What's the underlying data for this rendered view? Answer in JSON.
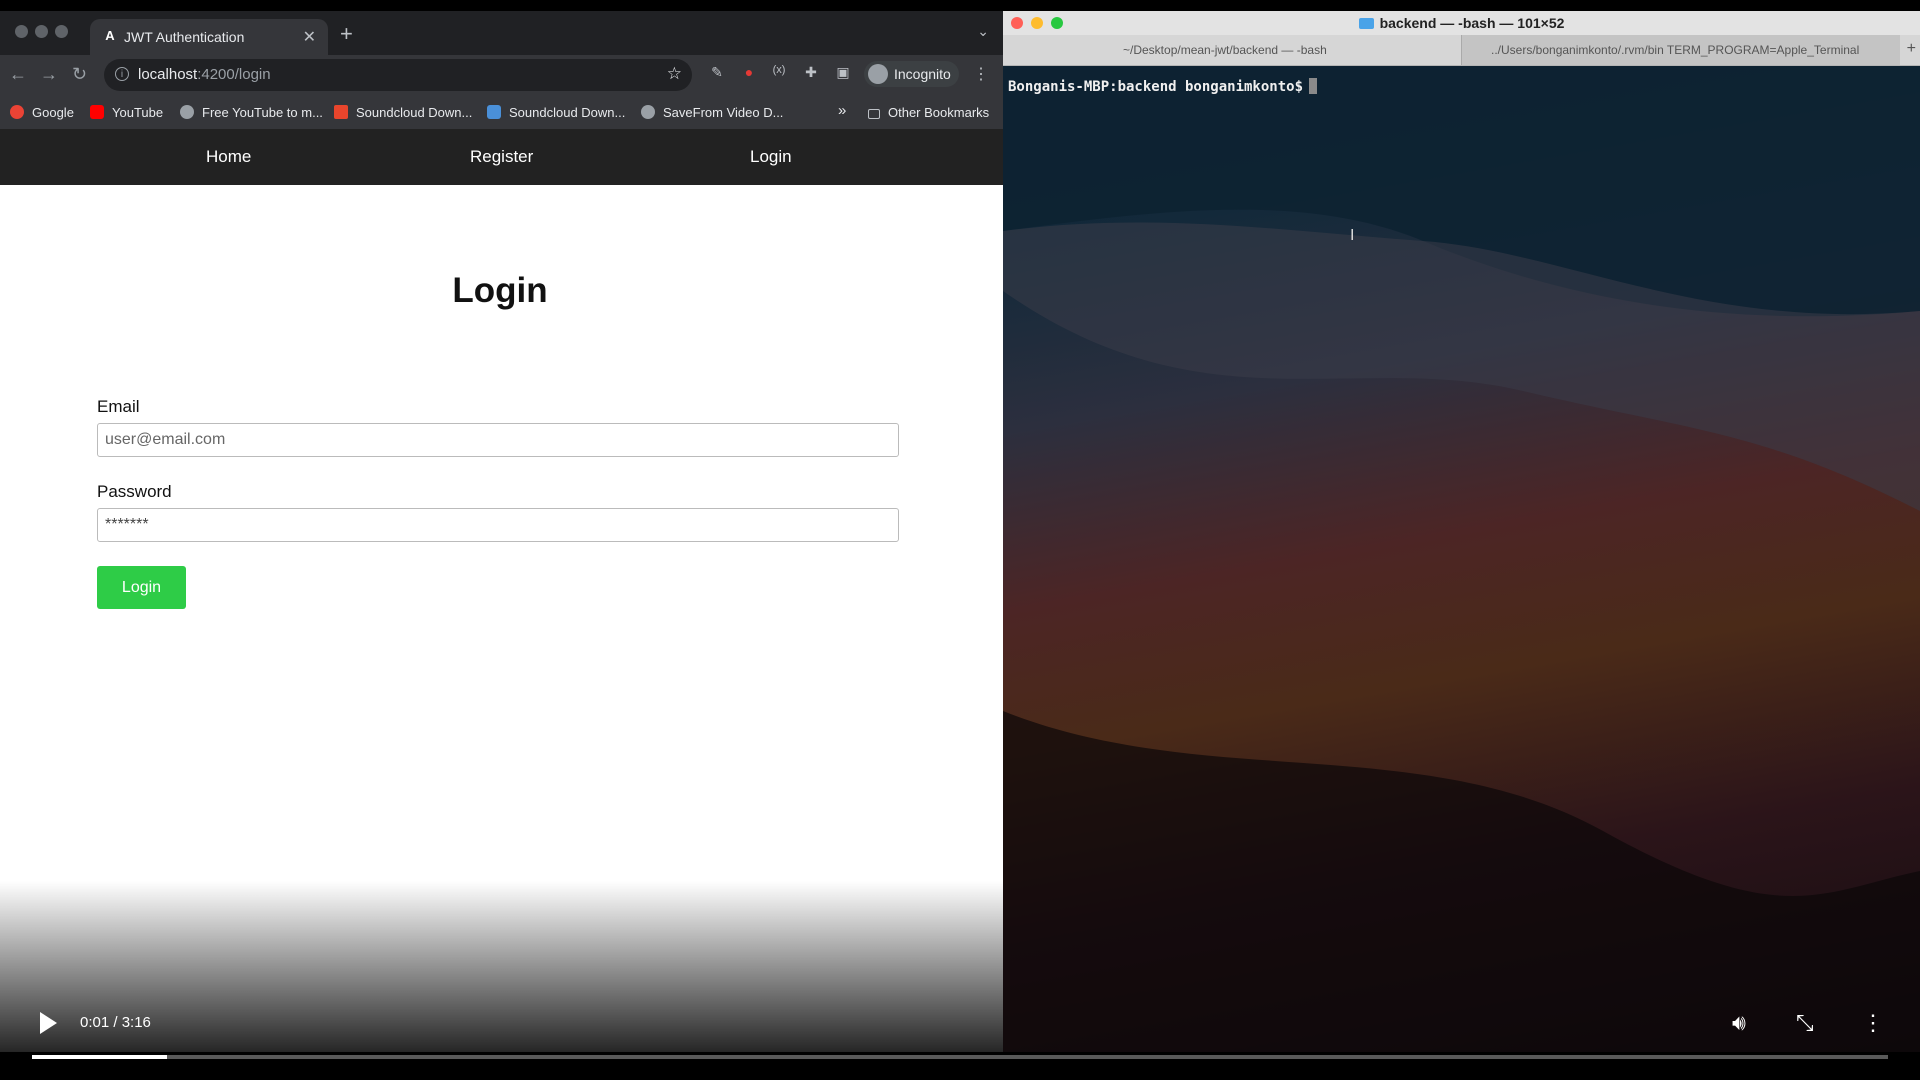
{
  "browser": {
    "tab_title": "JWT Authentication",
    "tab_favicon": "A",
    "url_host": "localhost",
    "url_path": ":4200/login",
    "incognito_label": "Incognito",
    "bookmarks": [
      {
        "label": "Google",
        "icon": "google-icon",
        "color": "#ea4335"
      },
      {
        "label": "YouTube",
        "icon": "youtube-icon",
        "color": "#ff0000"
      },
      {
        "label": "Free YouTube to m...",
        "icon": "globe-icon",
        "color": "#9aa0a6"
      },
      {
        "label": "Soundcloud Down...",
        "icon": "download-icon",
        "color": "#e8452c"
      },
      {
        "label": "Soundcloud Down...",
        "icon": "cloud-icon",
        "color": "#4a90d9"
      },
      {
        "label": "SaveFrom Video D...",
        "icon": "globe-icon",
        "color": "#9aa0a6"
      }
    ],
    "more_bookmarks": "»",
    "other_bookmarks": "Other Bookmarks"
  },
  "app": {
    "nav": {
      "home": "Home",
      "register": "Register",
      "login": "Login"
    },
    "title": "Login",
    "email_label": "Email",
    "email_placeholder": "user@email.com",
    "password_label": "Password",
    "password_value": "*******",
    "login_button": "Login",
    "accent_color": "#2ecc47"
  },
  "terminal": {
    "window_title": "backend — -bash — 101×52",
    "tab1": "~/Desktop/mean-jwt/backend — -bash",
    "tab2": "../Users/bonganimkonto/.rvm/bin TERM_PROGRAM=Apple_Terminal",
    "prompt": "Bonganis-MBP:backend bonganimkonto$"
  },
  "video": {
    "time": "0:01 / 3:16",
    "progress_fraction": 0.073
  }
}
